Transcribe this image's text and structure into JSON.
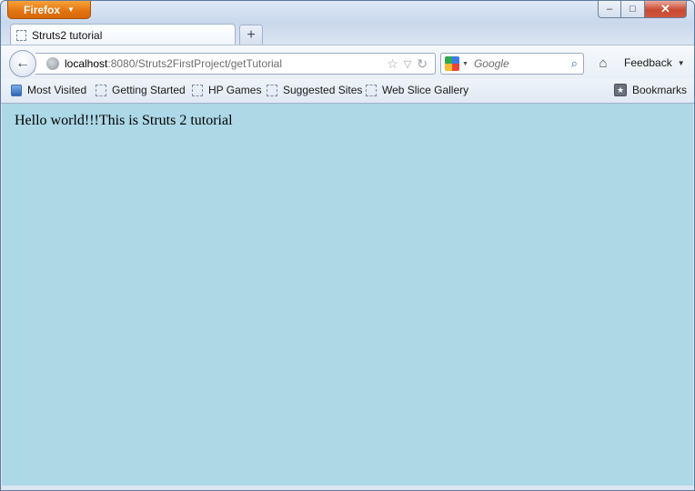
{
  "window": {
    "app_button": "Firefox",
    "controls": {
      "minimize": "–",
      "maximize": "□",
      "close": "✕"
    }
  },
  "tabs": [
    {
      "title": "Struts2 tutorial",
      "active": true
    }
  ],
  "new_tab_glyph": "+",
  "navbar": {
    "back_glyph": "←",
    "url_host": "localhost",
    "url_rest": ":8080/Struts2FirstProject/getTutorial",
    "bookmark_star_glyph": "☆",
    "dropdown_glyph": "▽",
    "reload_glyph": "↻",
    "search_placeholder": "Google",
    "search_glyph": "⌕",
    "home_glyph": "⌂",
    "feedback_label": "Feedback",
    "feedback_caret": "▼"
  },
  "bookmarks": {
    "items": [
      {
        "label": "Most Visited"
      },
      {
        "label": "Getting Started"
      },
      {
        "label": "HP Games"
      },
      {
        "label": "Suggested Sites"
      },
      {
        "label": "Web Slice Gallery"
      }
    ],
    "menu_label": "Bookmarks",
    "menu_icon_glyph": "★"
  },
  "page": {
    "background_color": "#add8e6",
    "text": "Hello world!!!This is Struts 2 tutorial"
  },
  "colors": {
    "firefox_button": "#e3730f",
    "close_button": "#c84a32"
  }
}
